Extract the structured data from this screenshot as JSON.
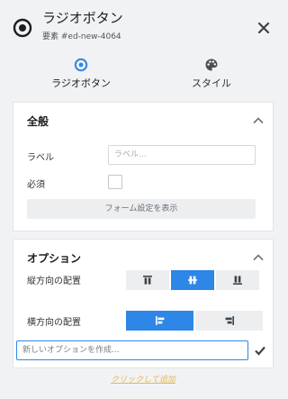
{
  "header": {
    "title": "ラジオボタン",
    "subtitle": "要素 #ed-new-4064",
    "icon": "radio-button-icon",
    "close_icon": "close-icon"
  },
  "tabs": [
    {
      "label": "ラジオボタン",
      "icon": "radio-target-icon",
      "active": true
    },
    {
      "label": "スタイル",
      "icon": "palette-icon",
      "active": false
    }
  ],
  "general": {
    "title": "全般",
    "label_field": {
      "label": "ラベル",
      "placeholder": "ラベル..."
    },
    "required_field": {
      "label": "必須",
      "checked": false
    },
    "form_settings_button": "フォーム設定を表示"
  },
  "options": {
    "title": "オプション",
    "vertical_align": {
      "label": "縦方向の配置",
      "choices": [
        "align-top-icon",
        "align-middle-icon",
        "align-bottom-icon"
      ],
      "selected": "align-middle-icon"
    },
    "horizontal_align": {
      "label": "横方向の配置",
      "choices": [
        "align-left-icon",
        "align-right-icon"
      ],
      "selected": "align-left-icon"
    },
    "new_option_placeholder": "新しいオプションを作成...",
    "add_link": "クリックして追加"
  },
  "colors": {
    "accent": "#2e86e6",
    "link": "#e8b94a",
    "background": "#f1f2f4"
  }
}
